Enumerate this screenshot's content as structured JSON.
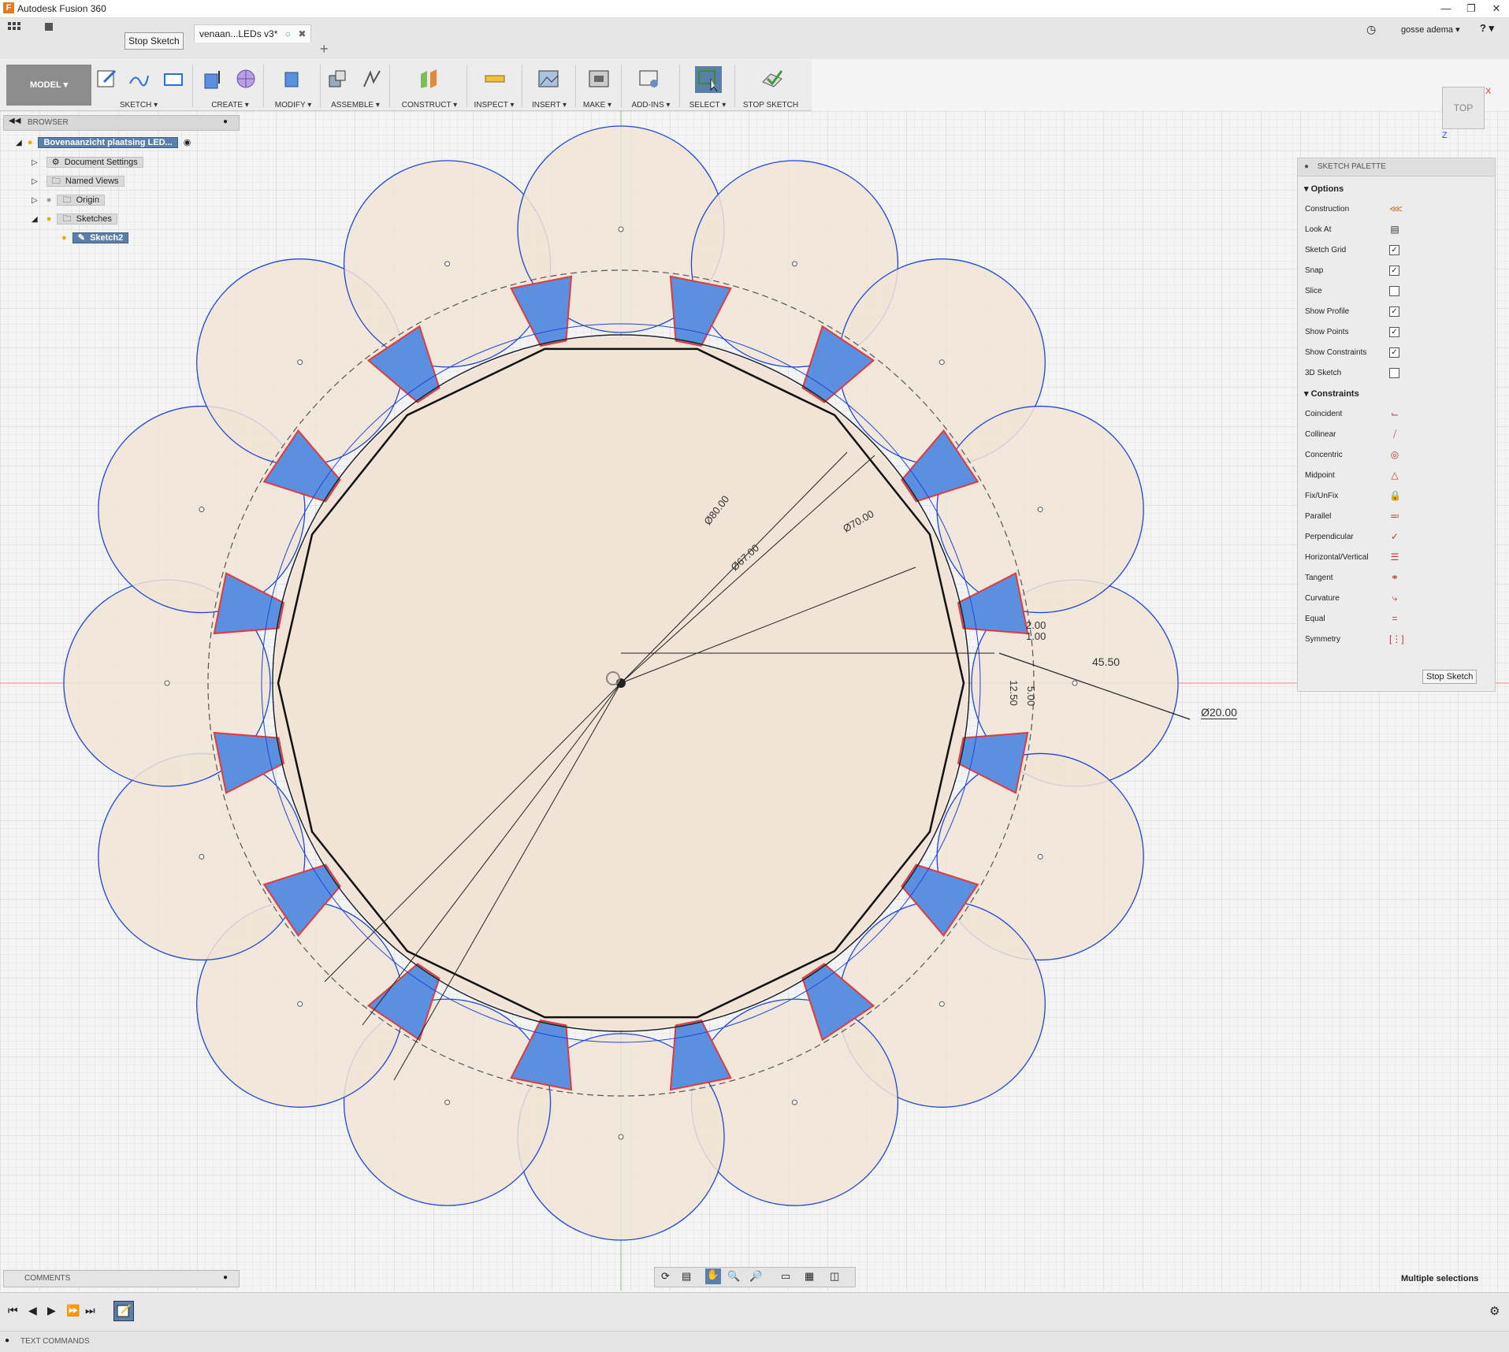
{
  "window": {
    "title": "Autodesk Fusion 360",
    "app_icon": "F"
  },
  "user": {
    "name": "gosse adema ▾",
    "help": "? ▾"
  },
  "tab": {
    "label": "venaan...LEDs v3*",
    "add": "+"
  },
  "tooltip": "Stop Sketch",
  "toolbar": {
    "mode": "MODEL ▾",
    "groups": [
      "SKETCH ▾",
      "CREATE ▾",
      "MODIFY ▾",
      "ASSEMBLE ▾",
      "CONSTRUCT ▾",
      "INSPECT ▾",
      "INSERT ▾",
      "MAKE ▾",
      "ADD-INS ▾",
      "SELECT ▾",
      "STOP SKETCH"
    ]
  },
  "browser": {
    "title": "BROWSER",
    "root": "Bovenaanzicht plaatsing LED...",
    "items": [
      "Document Settings",
      "Named Views",
      "Origin",
      "Sketches"
    ],
    "active_sketch": "Sketch2"
  },
  "viewcube": {
    "face": "TOP",
    "x": "X",
    "z": "Z"
  },
  "dimensions": [
    "Ø80.00",
    "Ø67.00",
    "Ø70.00",
    "2.00",
    "1.00",
    "45.50",
    "12.50",
    "5.00",
    "Ø20.00"
  ],
  "palette": {
    "title": "SKETCH PALETTE",
    "options_title": "Options",
    "options": [
      {
        "label": "Construction",
        "checked": null,
        "icon": "construction-icon"
      },
      {
        "label": "Look At",
        "checked": null,
        "icon": "look-at-icon"
      },
      {
        "label": "Sketch Grid",
        "checked": true
      },
      {
        "label": "Snap",
        "checked": true
      },
      {
        "label": "Slice",
        "checked": false
      },
      {
        "label": "Show Profile",
        "checked": true
      },
      {
        "label": "Show Points",
        "checked": true
      },
      {
        "label": "Show Constraints",
        "checked": true
      },
      {
        "label": "3D Sketch",
        "checked": false
      }
    ],
    "constraints_title": "Constraints",
    "constraints": [
      "Coincident",
      "Collinear",
      "Concentric",
      "Midpoint",
      "Fix/UnFix",
      "Parallel",
      "Perpendicular",
      "Horizontal/Vertical",
      "Tangent",
      "Curvature",
      "Equal",
      "Symmetry"
    ],
    "stop_button": "Stop Sketch"
  },
  "comments": "COMMENTS",
  "status": "Multiple selections",
  "textcommands": "TEXT COMMANDS",
  "colors": {
    "profile_fill": "#5b8fe0",
    "circle_stroke": "#1f47d6",
    "region_fill": "#f1e4d6",
    "red_edge": "#e23a3a"
  }
}
